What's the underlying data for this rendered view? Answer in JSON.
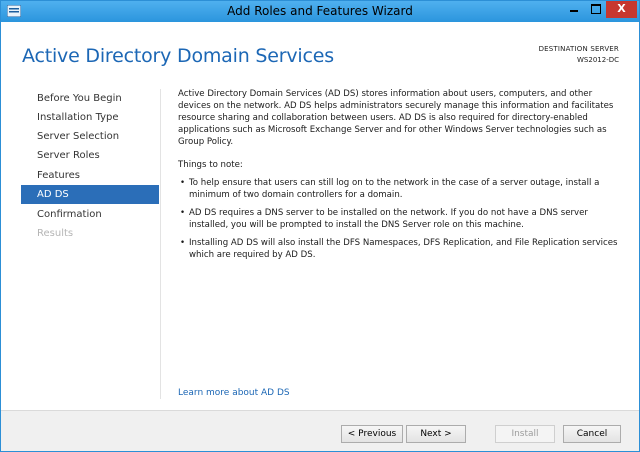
{
  "window": {
    "title": "Add Roles and Features Wizard",
    "controls": {
      "minimize": "",
      "maximize": "",
      "close": "X"
    }
  },
  "header": {
    "page_title": "Active Directory Domain Services",
    "destination_label": "DESTINATION SERVER",
    "destination_server": "WS2012-DC"
  },
  "nav": {
    "items": [
      {
        "label": "Before You Begin",
        "state": "normal"
      },
      {
        "label": "Installation Type",
        "state": "normal"
      },
      {
        "label": "Server Selection",
        "state": "normal"
      },
      {
        "label": "Server Roles",
        "state": "normal"
      },
      {
        "label": "Features",
        "state": "normal"
      },
      {
        "label": "AD DS",
        "state": "selected"
      },
      {
        "label": "Confirmation",
        "state": "normal"
      },
      {
        "label": "Results",
        "state": "disabled"
      }
    ]
  },
  "content": {
    "intro": "Active Directory Domain Services (AD DS) stores information about users, computers, and other devices on the network.  AD DS helps administrators securely manage this information and facilitates resource sharing and collaboration between users.  AD DS is also required for directory-enabled applications such as Microsoft Exchange Server and for other Windows Server technologies such as Group Policy.",
    "things_heading": "Things to note:",
    "bullets": [
      "To help ensure that users can still log on to the network in the case of a server outage, install a minimum of two domain controllers for a domain.",
      "AD DS requires a DNS server to be installed on the network.  If you do not have a DNS server installed, you will be prompted to install the DNS Server role on this machine.",
      "Installing AD DS will also install the DFS Namespaces, DFS Replication, and File Replication services which are required by AD DS."
    ],
    "bullet_glyph": "•",
    "learn_more": "Learn more about AD DS"
  },
  "footer": {
    "previous": "< Previous",
    "next": "Next >",
    "install": "Install",
    "cancel": "Cancel"
  },
  "colors": {
    "titlebar": "#2b95dd",
    "heading": "#1c67b5",
    "nav_selected": "#2b6eb8",
    "close_button": "#c7372f"
  },
  "icons": {
    "app": "wizard-app-icon",
    "minimize": "minimize-icon",
    "maximize": "maximize-icon",
    "close": "close-icon"
  }
}
